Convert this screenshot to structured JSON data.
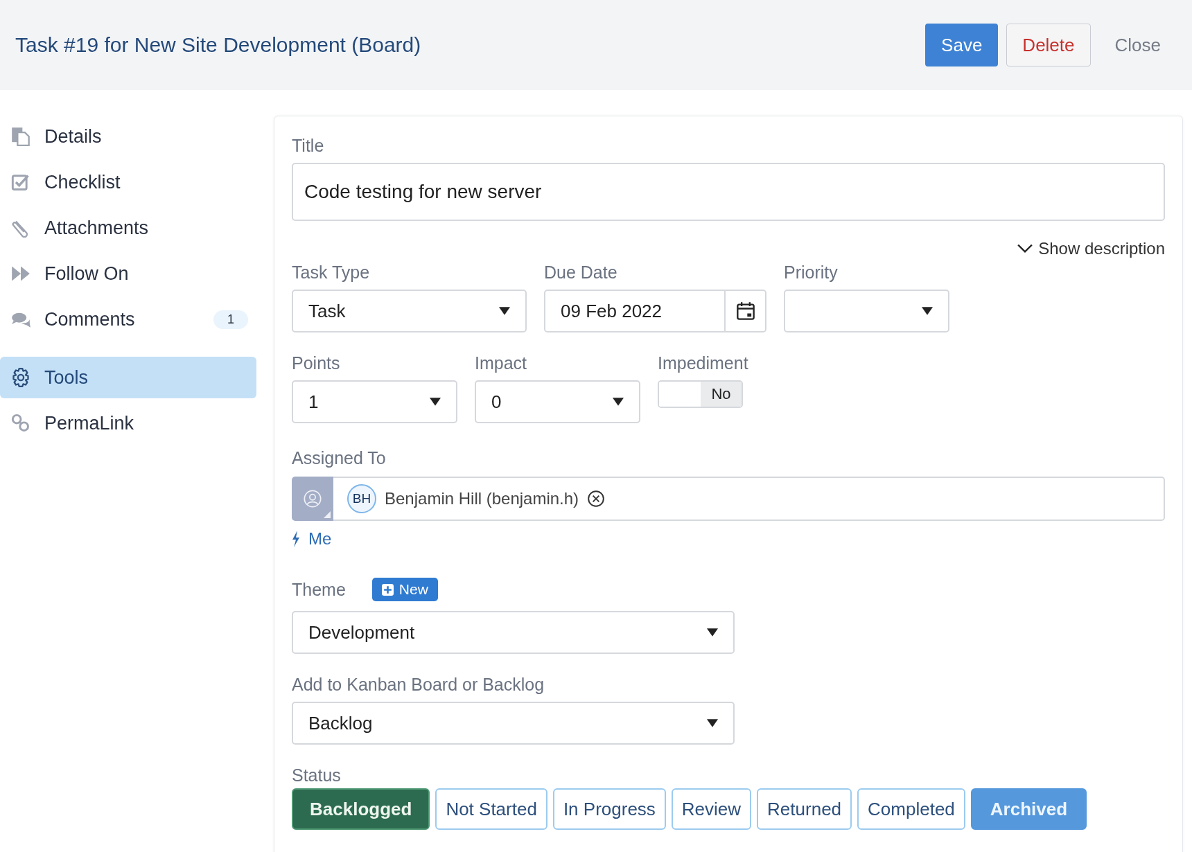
{
  "header": {
    "title": "Task #19 for New Site Development (Board)",
    "buttons": [
      {
        "label": "Save",
        "kind": "primary"
      },
      {
        "label": "Delete",
        "kind": "danger"
      },
      {
        "label": "Close",
        "kind": "plain"
      }
    ]
  },
  "sidebar": {
    "items": [
      {
        "label": "Details",
        "selected": false
      },
      {
        "label": "Checklist",
        "selected": false
      },
      {
        "label": "Attachments",
        "selected": false
      },
      {
        "label": "Follow On",
        "selected": false
      },
      {
        "label": "Comments",
        "selected": false,
        "count": "1"
      },
      {
        "label": "Tools",
        "selected": true
      },
      {
        "label": "PermaLink",
        "selected": false
      }
    ]
  },
  "form": {
    "title": {
      "label": "Title",
      "value": "Code testing for new server"
    },
    "show_description": "Show description",
    "task_type": {
      "label": "Task Type",
      "value": "Task"
    },
    "due_date": {
      "label": "Due Date",
      "value": "09 Feb 2022"
    },
    "priority": {
      "label": "Priority"
    },
    "points": {
      "label": "Points",
      "value": "1"
    },
    "impact": {
      "label": "Impact",
      "value": "0"
    },
    "impediment": {
      "label": "Impediment",
      "on": false,
      "text": "No"
    },
    "assigned_to": {
      "label": "Assigned To",
      "assignees": [
        {
          "initials": "BH",
          "name": "Benjamin Hill (benjamin.h)"
        }
      ],
      "me_link": "Me"
    },
    "theme": {
      "label": "Theme",
      "new_button": "New",
      "value": "Development"
    },
    "board": {
      "label": "Add to Kanban Board or Backlog",
      "value": "Backlog"
    },
    "status": {
      "label": "Status",
      "options": [
        {
          "label": "Backlogged",
          "kind": "status",
          "selected": true
        },
        {
          "label": "Not Started",
          "kind": "status",
          "selected": false
        },
        {
          "label": "In Progress",
          "kind": "status",
          "selected": false
        },
        {
          "label": "Review",
          "kind": "status",
          "selected": false
        },
        {
          "label": "Returned",
          "kind": "status",
          "selected": false
        },
        {
          "label": "Completed",
          "kind": "status",
          "selected": false
        },
        {
          "label": "Archived",
          "kind": "archive",
          "selected": false
        }
      ]
    }
  }
}
